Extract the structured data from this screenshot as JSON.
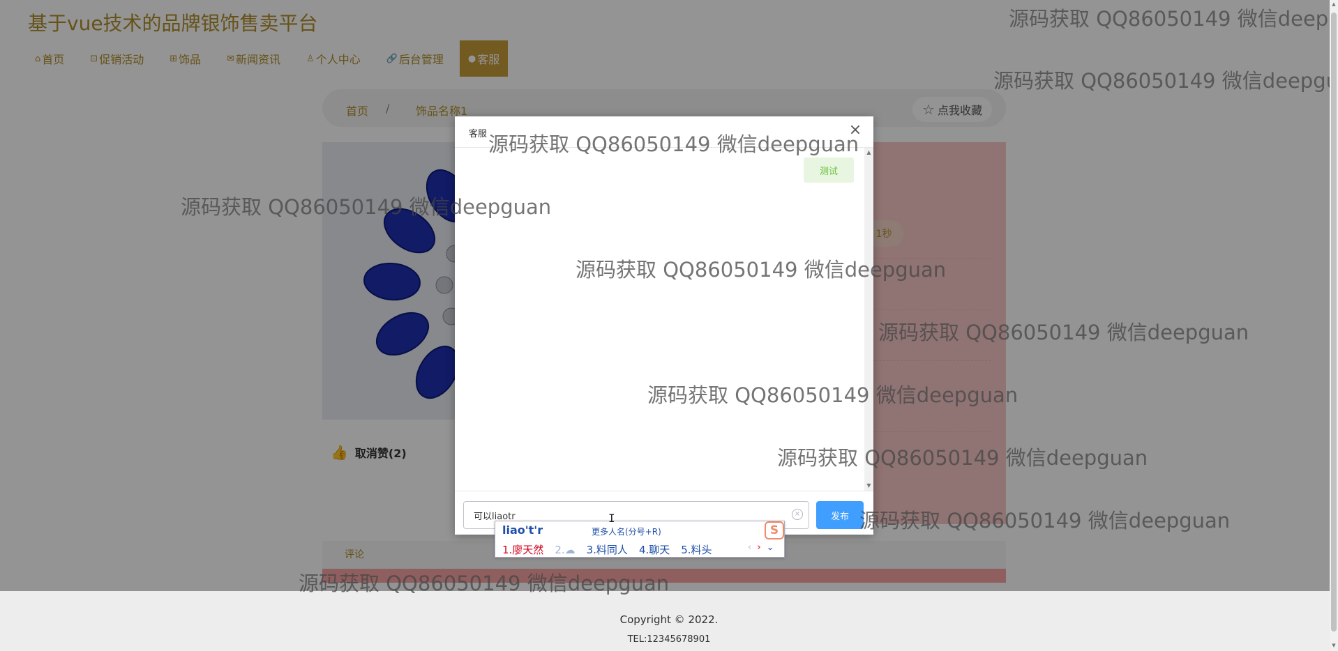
{
  "site": {
    "title": "基于vue技术的品牌银饰售卖平台"
  },
  "nav": {
    "items": [
      {
        "icon": "⌂",
        "label": "首页"
      },
      {
        "icon": "⊡",
        "label": "促销活动"
      },
      {
        "icon": "⊞",
        "label": "饰品"
      },
      {
        "icon": "✉",
        "label": "新闻资讯"
      },
      {
        "icon": "♙",
        "label": "个人中心"
      },
      {
        "icon": "🔗",
        "label": "后台管理"
      },
      {
        "icon": "●",
        "label": "客服"
      }
    ]
  },
  "breadcrumb": {
    "home": "首页",
    "separator": "/",
    "current": "饰品名称1"
  },
  "favorite": {
    "label": "点我收藏"
  },
  "product": {
    "timer_text": "1秒",
    "like_label": "取消赞(2)"
  },
  "comments": {
    "tab_label": "评论"
  },
  "footer": {
    "copyright": "Copyright © 2022.",
    "tel": "TEL:12345678901"
  },
  "dialog": {
    "title": "客服",
    "close": "×",
    "messages": [
      {
        "text": "测试"
      }
    ],
    "input_value": "可以liaotr",
    "send_label": "发布"
  },
  "ime": {
    "composition": "liao't'r",
    "hint": "更多人名(分号+R)",
    "candidates": [
      "1.廖天然",
      "2.",
      "3.料同人",
      "4.聊天",
      "5.料头"
    ],
    "prev": "‹",
    "next": "›",
    "more": "⌄",
    "logo": "S"
  },
  "watermark": {
    "text": "源码获取 QQ86050149 微信deepguan"
  }
}
